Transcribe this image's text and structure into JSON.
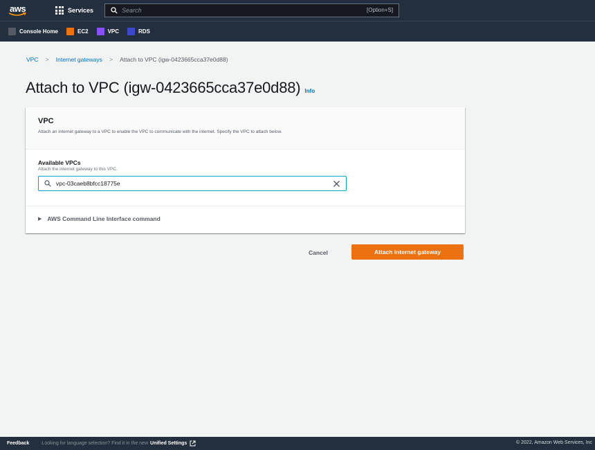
{
  "topnav": {
    "logo_text": "aws",
    "services_label": "Services",
    "search_placeholder": "Search",
    "search_shortcut": "[Option+S]"
  },
  "favorites": [
    {
      "label": "Console Home",
      "icon": "console-home-icon",
      "color": "#545b64"
    },
    {
      "label": "EC2",
      "icon": "ec2-icon",
      "color": "#ec7211"
    },
    {
      "label": "VPC",
      "icon": "vpc-icon",
      "color": "#8c4fff"
    },
    {
      "label": "RDS",
      "icon": "rds-icon",
      "color": "#3b48cc"
    }
  ],
  "breadcrumb": {
    "items": [
      "VPC",
      "Internet gateways"
    ],
    "current": "Attach to VPC (igw-0423665cca37e0d88)"
  },
  "page": {
    "title": "Attach to VPC (igw-0423665cca37e0d88)",
    "info_label": "Info"
  },
  "card": {
    "header_title": "VPC",
    "header_desc": "Attach an internet gateway to a VPC to enable the VPC to communicate with the internet. Specify the VPC to attach below.",
    "field_label": "Available VPCs",
    "field_desc": "Attach the internet gateway to this VPC.",
    "field_value": "vpc-03caeb8bfcc18775e",
    "cli_label": "AWS Command Line Interface command"
  },
  "actions": {
    "cancel_label": "Cancel",
    "attach_label": "Attach internet gateway"
  },
  "footer": {
    "feedback_label": "Feedback",
    "message": "Looking for language selection? Find it in the new",
    "settings_link": "Unified Settings",
    "copyright": "© 2022, Amazon Web Services, Inc"
  },
  "colors": {
    "nav_bg": "#232f3e",
    "link": "#0073bb",
    "primary_button": "#ec7211",
    "focus_border": "#00a1c9"
  }
}
